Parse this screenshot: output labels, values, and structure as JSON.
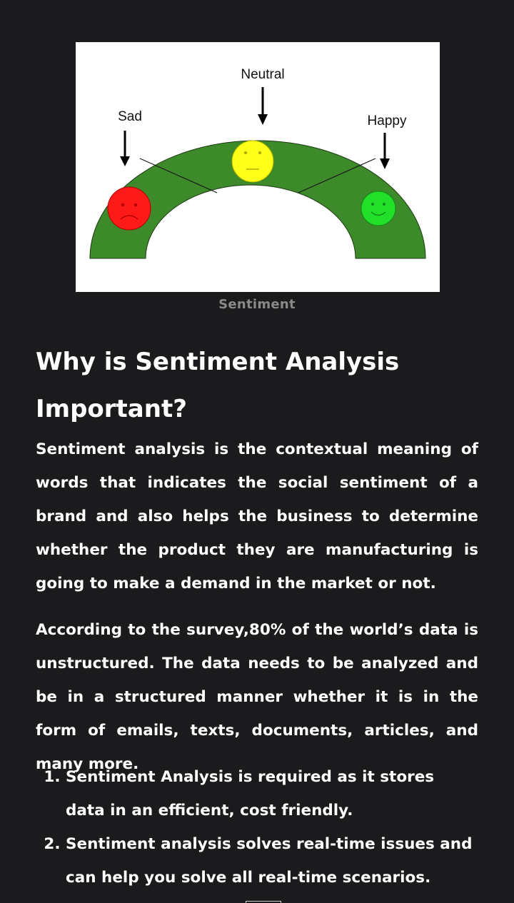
{
  "figure": {
    "labels": {
      "sad": "Sad",
      "neutral": "Neutral",
      "happy": "Happy"
    },
    "caption": "Sentiment",
    "colors": {
      "arc": "#3c8a2a",
      "sad_face": "#ff1a1a",
      "neutral_face": "#ffff1a",
      "happy_face": "#22e02a"
    }
  },
  "article": {
    "heading": "Why is Sentiment Analysis Important?",
    "paragraphs": [
      "Sentiment analysis is the contextual meaning of words that indicates the social sentiment of a brand and also helps the business to determine whether the product they are manufacturing is going to make a demand in the market or not.",
      "According to the survey,80% of the world’s data is unstructured. The data needs to be analyzed and be in a structured manner whether it is in the form of emails, texts, documents, articles, and many more."
    ],
    "list": [
      "Sentiment Analysis is required as it stores data in an efficient, cost friendly.",
      "Sentiment analysis solves real-time issues and can help you solve all real-time scenarios."
    ]
  }
}
